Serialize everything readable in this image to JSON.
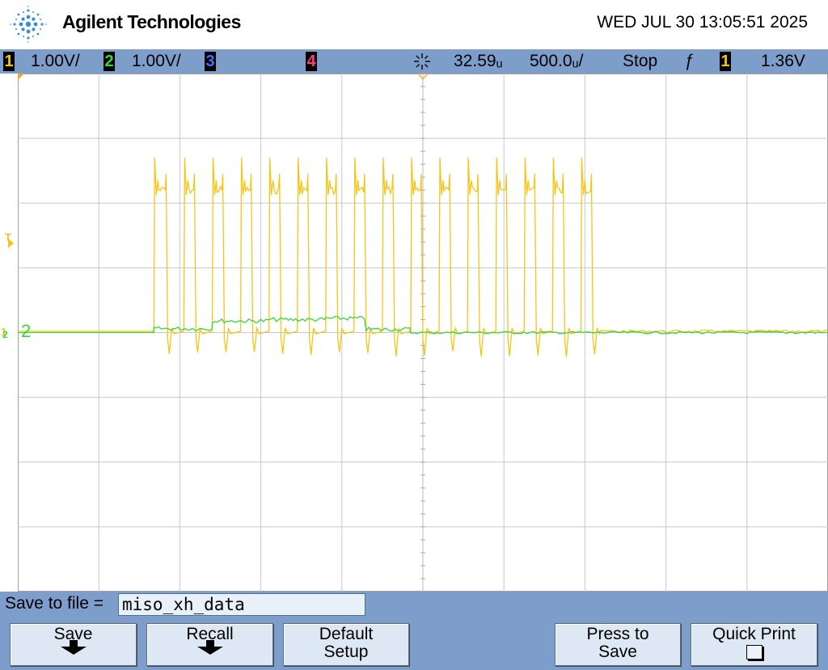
{
  "header": {
    "brand": "Agilent Technologies",
    "datetime": "WED JUL 30 13:05:51 2025"
  },
  "status_bar": {
    "ch1": {
      "num": "1",
      "scale": "1.00V/",
      "color": "#f5c518"
    },
    "ch2": {
      "num": "2",
      "scale": "1.00V/",
      "color": "#39d83a"
    },
    "ch3": {
      "num": "3",
      "color": "#4a6cff"
    },
    "ch4": {
      "num": "4",
      "color": "#ff3b7f"
    },
    "delay": "32.59ᵤ",
    "timebase": "500.0ᵤ/",
    "run_state": "Stop",
    "trigger_slope": "ƒ",
    "trigger_source": "1",
    "trigger_level": "1.36V"
  },
  "markers": {
    "trigger_marker": "T",
    "ch1_ground": "1",
    "ch2_ground": "2",
    "ch2_label": "2"
  },
  "chart_data": {
    "type": "line",
    "x_divisions": 10,
    "y_divisions": 8,
    "series": [
      {
        "name": "1",
        "color": "#f5c518",
        "baseline_div": 4.02,
        "high_div": 6.2,
        "pulses": [
          {
            "start": 1.68,
            "end": 1.85
          },
          {
            "start": 2.05,
            "end": 2.2
          },
          {
            "start": 2.4,
            "end": 2.55
          },
          {
            "start": 2.75,
            "end": 2.9
          },
          {
            "start": 3.1,
            "end": 3.25
          },
          {
            "start": 3.45,
            "end": 3.6
          },
          {
            "start": 3.8,
            "end": 3.95
          },
          {
            "start": 4.15,
            "end": 4.3
          },
          {
            "start": 4.5,
            "end": 4.65
          },
          {
            "start": 4.85,
            "end": 5.0
          },
          {
            "start": 5.2,
            "end": 5.35
          },
          {
            "start": 5.55,
            "end": 5.7
          },
          {
            "start": 5.9,
            "end": 6.05
          },
          {
            "start": 6.25,
            "end": 6.4
          },
          {
            "start": 6.6,
            "end": 6.75
          },
          {
            "start": 6.95,
            "end": 7.1
          }
        ]
      },
      {
        "name": "2",
        "color": "#39d83a",
        "baseline_div": 4.0,
        "bumps": [
          {
            "start": 1.68,
            "end": 2.4,
            "level": 4.06
          },
          {
            "start": 2.4,
            "end": 3.1,
            "level": 4.18
          },
          {
            "start": 3.1,
            "end": 3.8,
            "level": 4.2
          },
          {
            "start": 3.8,
            "end": 4.3,
            "level": 4.22
          },
          {
            "start": 4.3,
            "end": 4.85,
            "level": 4.05
          }
        ]
      }
    ]
  },
  "bottom": {
    "save_to_file_label": "Save to file =",
    "filename": "miso_xh_data",
    "softkeys": {
      "save": "Save",
      "recall": "Recall",
      "default_line1": "Default",
      "default_line2": "Setup",
      "press_line1": "Press to",
      "press_line2": "Save",
      "quick_print": "Quick Print"
    }
  }
}
